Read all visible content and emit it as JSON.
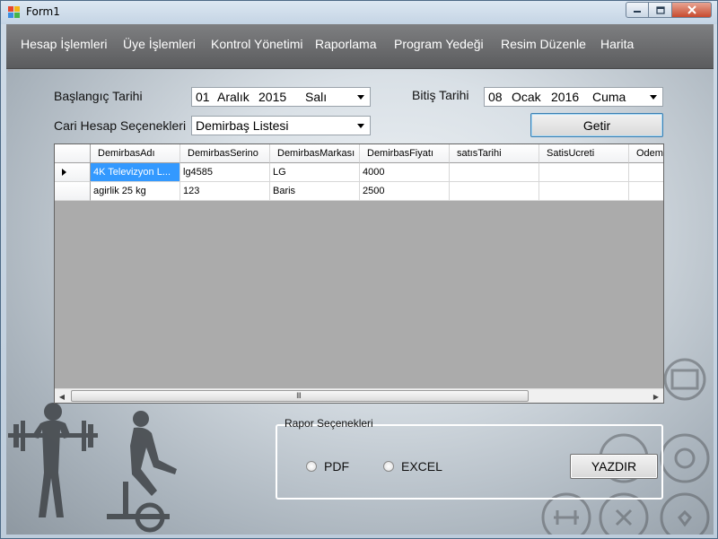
{
  "window": {
    "title": "Form1",
    "min_glyph": "🗕",
    "max_glyph": "🗖",
    "close_glyph": "✕"
  },
  "menu": [
    "Hesap İşlemleri",
    "Üye İşlemleri",
    "Kontrol Yönetimi",
    "Raporlama",
    "Program Yedeği",
    "Resim Düzenle",
    "Harita"
  ],
  "filters": {
    "start_label": "Başlangıç Tarihi",
    "start_date": {
      "day": "01",
      "month": "Aralık",
      "year": "2015",
      "weekday": "Salı"
    },
    "end_label": "Bitiş Tarihi",
    "end_date": {
      "day": "08",
      "month": "Ocak",
      "year": "2016",
      "weekday": "Cuma"
    },
    "account_label": "Cari Hesap Seçenekleri",
    "account_value": "Demirbaş Listesi",
    "fetch_button": "Getir"
  },
  "grid": {
    "columns": [
      "DemirbasAdı",
      "DemirbasSerino",
      "DemirbasMarkası",
      "DemirbasFiyatı",
      "satısTarihi",
      "SatisUcreti",
      "Odeme"
    ],
    "rows": [
      [
        "4K Televizyon L...",
        "lg4585",
        "LG",
        "4000",
        "",
        "",
        ""
      ],
      [
        "agirlik 25 kg",
        "123",
        "Baris",
        "2500",
        "",
        "",
        ""
      ]
    ],
    "scroll_grip": "III"
  },
  "report": {
    "group_title": "Rapor Seçenekleri",
    "options": [
      "PDF",
      "EXCEL"
    ],
    "print_button": "YAZDIR"
  },
  "colors": {
    "menubar": "#5b5c5e",
    "selection": "#3399ff",
    "button_border": "#3c7fb1"
  },
  "icons": [
    "app-icon",
    "minimize-icon",
    "maximize-icon",
    "close-icon",
    "dropdown-arrow-icon",
    "row-indicator-icon",
    "scroll-left-icon",
    "scroll-right-icon"
  ]
}
